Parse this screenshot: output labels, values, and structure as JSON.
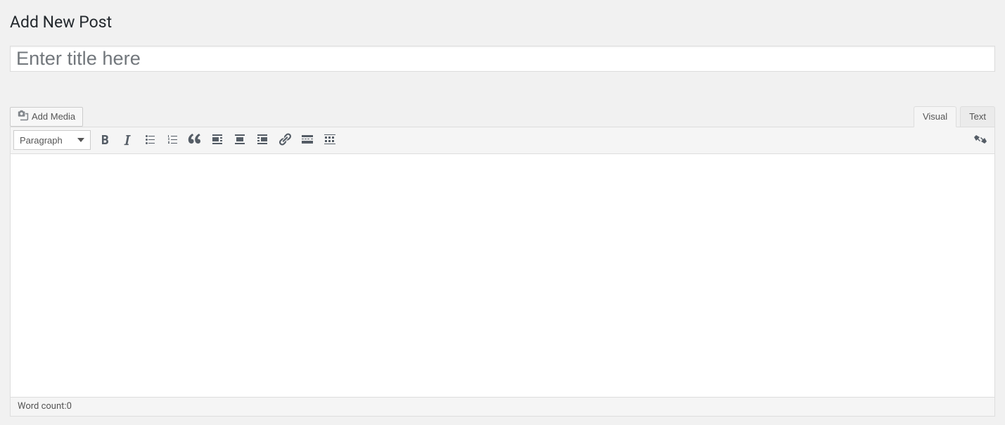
{
  "page": {
    "title": "Add New Post"
  },
  "title_field": {
    "value": "",
    "placeholder": "Enter title here"
  },
  "media": {
    "add_media_label": "Add Media"
  },
  "tabs": {
    "visual": "Visual",
    "text": "Text"
  },
  "toolbar": {
    "format_select": "Paragraph"
  },
  "status": {
    "word_count_label": "Word count: ",
    "word_count_value": "0"
  }
}
